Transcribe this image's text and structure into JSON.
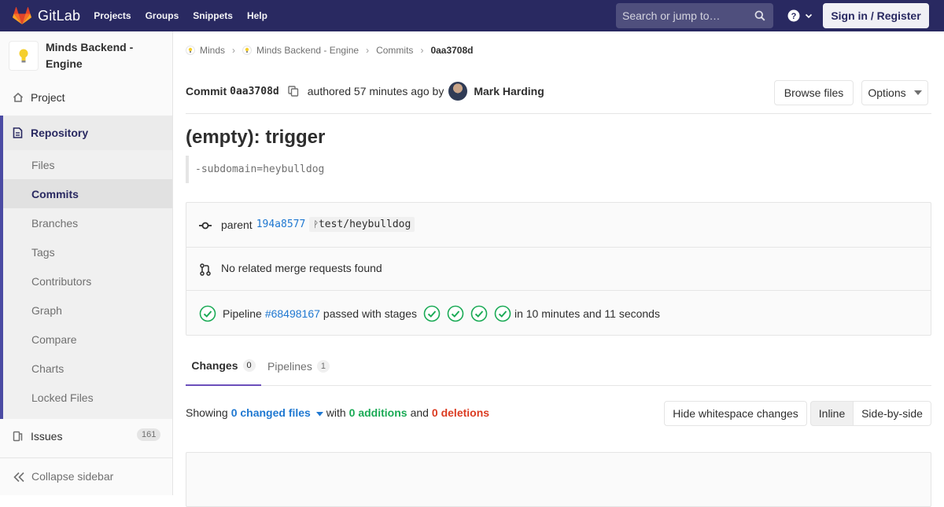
{
  "navbar": {
    "brand": "GitLab",
    "links": [
      "Projects",
      "Groups",
      "Snippets",
      "Help"
    ],
    "search_placeholder": "Search or jump to…",
    "sign_in": "Sign in / Register",
    "bg_color": "#292961"
  },
  "sidebar": {
    "project_name": "Minds Backend - Engine",
    "project_item": "Project",
    "repository": "Repository",
    "repo_items": [
      "Files",
      "Commits",
      "Branches",
      "Tags",
      "Contributors",
      "Graph",
      "Compare",
      "Charts",
      "Locked Files"
    ],
    "active_repo_item": "Commits",
    "issues": {
      "label": "Issues",
      "count": "161"
    },
    "collapse": "Collapse sidebar"
  },
  "breadcrumb": {
    "items": [
      "Minds",
      "Minds Backend - Engine",
      "Commits"
    ],
    "current": "0aa3708d"
  },
  "commit_header": {
    "prefix": "Commit",
    "sha": "0aa3708d",
    "authored": "authored 57 minutes ago by",
    "author": "Mark Harding",
    "browse_files": "Browse files",
    "options": "Options"
  },
  "commit": {
    "title": "(empty): trigger",
    "description": "-subdomain=heybulldog"
  },
  "info": {
    "parent_label": "parent",
    "parent_sha": "194a8577",
    "parent_ref": "test/heybulldog",
    "merge_requests": "No related merge requests found",
    "pipeline_prefix": "Pipeline",
    "pipeline_id": "#68498167",
    "pipeline_status": "passed with stages",
    "pipeline_duration": "in 10 minutes and 11 seconds",
    "stage_count": 4
  },
  "tabs": [
    {
      "label": "Changes",
      "count": "0"
    },
    {
      "label": "Pipelines",
      "count": "1"
    }
  ],
  "diff_summary": {
    "showing": "Showing",
    "changed_files": "0 changed files",
    "with": "with",
    "additions": "0 additions",
    "and": "and",
    "deletions": "0 deletions",
    "hide_whitespace": "Hide whitespace changes",
    "inline": "Inline",
    "side_by_side": "Side-by-side"
  },
  "colors": {
    "accent": "#4b4ba3",
    "link": "#1f78d1",
    "success": "#1aaa55",
    "danger": "#db3b21",
    "tab_underline": "#6b4fbb"
  }
}
